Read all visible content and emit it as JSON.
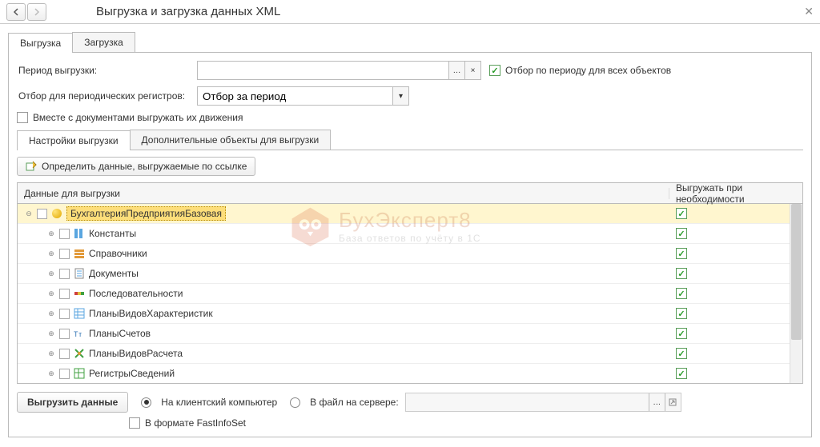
{
  "window": {
    "title": "Выгрузка и загрузка данных XML"
  },
  "tabs": {
    "export": "Выгрузка",
    "import": "Загрузка"
  },
  "fields": {
    "period_label": "Период выгрузки:",
    "period_value": "",
    "period_filter_all": "Отбор по периоду для всех объектов",
    "periodic_registers_label": "Отбор для периодических регистров:",
    "periodic_registers_value": "Отбор за период",
    "export_movements": "Вместе с документами выгружать их движения"
  },
  "inner_tabs": {
    "settings": "Настройки выгрузки",
    "additional": "Дополнительные объекты для выгрузки"
  },
  "buttons": {
    "determine_by_link": "Определить данные, выгружаемые по ссылке",
    "export": "Выгрузить данные"
  },
  "table": {
    "header_data": "Данные для выгрузки",
    "header_required": "Выгружать при необходимости",
    "rows": [
      {
        "label": "БухгалтерияПредприятияБазовая",
        "icon": "ball",
        "selected": true,
        "indent": 0
      },
      {
        "label": "Константы",
        "icon": "constants",
        "indent": 1
      },
      {
        "label": "Справочники",
        "icon": "catalogs",
        "indent": 1
      },
      {
        "label": "Документы",
        "icon": "documents",
        "indent": 1
      },
      {
        "label": "Последовательности",
        "icon": "sequences",
        "indent": 1
      },
      {
        "label": "ПланыВидовХарактеристик",
        "icon": "chart-char",
        "indent": 1
      },
      {
        "label": "ПланыСчетов",
        "icon": "chart-acc",
        "indent": 1
      },
      {
        "label": "ПланыВидовРасчета",
        "icon": "chart-calc",
        "indent": 1
      },
      {
        "label": "РегистрыСведений",
        "icon": "info-reg",
        "indent": 1
      }
    ]
  },
  "footer": {
    "to_client": "На клиентский компьютер",
    "to_server": "В файл на сервере:",
    "server_path": "",
    "fastinfoset": "В формате FastInfoSet"
  },
  "watermark": {
    "main": "БухЭксперт8",
    "sub": "База ответов по учёту в 1С"
  }
}
